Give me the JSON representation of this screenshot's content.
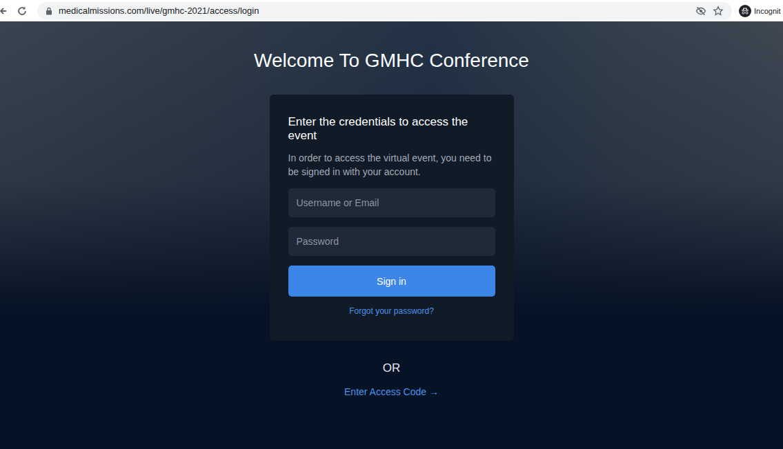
{
  "browser": {
    "url": "medicalmissions.com/live/gmhc-2021/access/login",
    "profile_label": "Incognit"
  },
  "page": {
    "title": "Welcome To GMHC Conference"
  },
  "login_card": {
    "heading": "Enter the credentials to access the event",
    "description": "In order to access the virtual event, you need to be signed in with your account.",
    "fields": [
      {
        "placeholder": "Username or Email",
        "kind": "text"
      },
      {
        "placeholder": "Password",
        "kind": "password"
      }
    ],
    "submit": "Sign in",
    "forgot_link": "Forgot your password?"
  },
  "divider": "OR",
  "access_code_link": "Enter Access Code →"
}
